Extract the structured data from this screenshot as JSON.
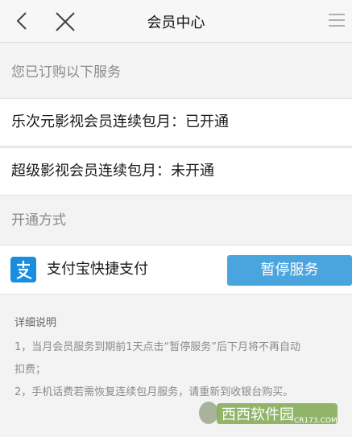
{
  "header": {
    "title": "会员中心"
  },
  "subscribed_section": {
    "label": "您已订购以下服务",
    "items": [
      "乐次元影视会员连续包月：已开通",
      "超级影视会员连续包月：未开通"
    ]
  },
  "method_section": {
    "label": "开通方式"
  },
  "payment": {
    "method_label": "支付宝快捷支付",
    "pause_button": "暂停服务",
    "icon": "alipay-icon",
    "accent": "#4aa5de"
  },
  "notes": {
    "heading": "详细说明",
    "lines": [
      "1，当月会员服务到期前1天点击“暂停服务”后下月将不再自动",
      "扣费；",
      "2，手机话费若需恢复连续包月服务，请重新到收银台购买。"
    ]
  },
  "watermark": {
    "brand": "西西软件园",
    "domain": "CR173.COM"
  }
}
